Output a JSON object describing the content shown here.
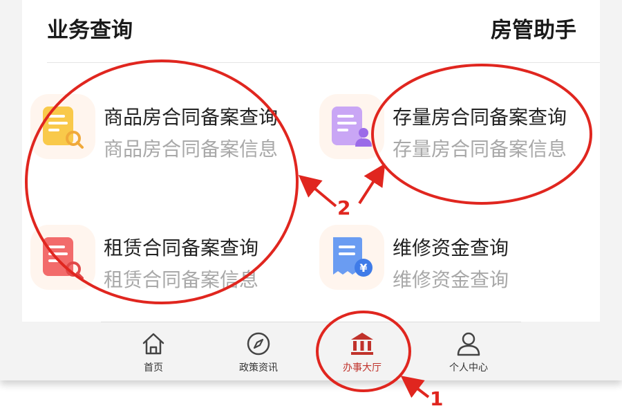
{
  "header": {
    "title": "业务查询",
    "right_text": "房管助手"
  },
  "services": [
    {
      "title": "商品房合同备案查询",
      "desc": "商品房合同备案信息",
      "icon": "document-search-icon",
      "color": "#f9c94a"
    },
    {
      "title": "存量房合同备案查询",
      "desc": "存量房合同备案信息",
      "icon": "document-user-icon",
      "color": "#b58cf0"
    },
    {
      "title": "租赁合同备案查询",
      "desc": "租赁合同备案信息",
      "icon": "document-search-icon",
      "color": "#f26b6b"
    },
    {
      "title": "维修资金查询",
      "desc": "维修资金查询",
      "icon": "receipt-yen-icon",
      "color": "#5b8ff0"
    }
  ],
  "tabbar": {
    "items": [
      {
        "label": "首页",
        "icon": "home-icon"
      },
      {
        "label": "政策资讯",
        "icon": "compass-icon"
      },
      {
        "label": "办事大厅",
        "icon": "bank-building-icon",
        "active": true
      },
      {
        "label": "个人中心",
        "icon": "user-icon"
      }
    ],
    "active_color": "#c0322b"
  },
  "annotations": {
    "label_1": "1",
    "label_2": "2",
    "color": "#e0261f"
  }
}
